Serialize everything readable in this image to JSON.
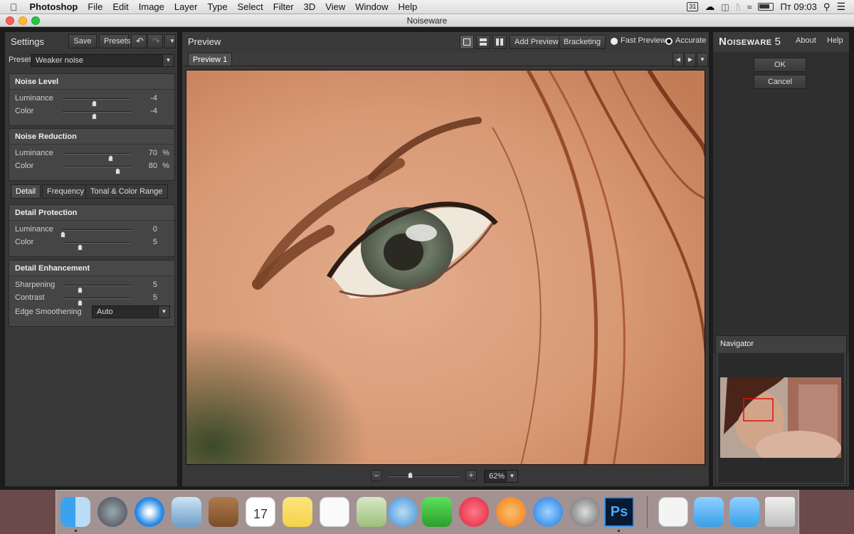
{
  "menubar": {
    "app_name": "Photoshop",
    "items": [
      "File",
      "Edit",
      "Image",
      "Layer",
      "Type",
      "Select",
      "Filter",
      "3D",
      "View",
      "Window",
      "Help"
    ],
    "calendar_tray": "31",
    "clock": "Пт 09:03"
  },
  "window": {
    "title": "Noiseware"
  },
  "settings": {
    "title": "Settings",
    "save_label": "Save",
    "presets_label": "Presets",
    "preset_label": "Preset",
    "preset_value": "Weaker noise",
    "noise_level": {
      "title": "Noise Level",
      "rows": [
        {
          "label": "Luminance",
          "value": "-4",
          "unit": "",
          "pos": 0.46
        },
        {
          "label": "Color",
          "value": "-4",
          "unit": "",
          "pos": 0.46
        }
      ]
    },
    "noise_reduction": {
      "title": "Noise Reduction",
      "rows": [
        {
          "label": "Luminance",
          "value": "70",
          "unit": "%",
          "pos": 0.7
        },
        {
          "label": "Color",
          "value": "80",
          "unit": "%",
          "pos": 0.8
        }
      ]
    },
    "tabs": [
      "Detail",
      "Frequency",
      "Tonal & Color Range"
    ],
    "detail_protection": {
      "title": "Detail Protection",
      "rows": [
        {
          "label": "Luminance",
          "value": "0",
          "unit": "",
          "pos": 0.0
        },
        {
          "label": "Color",
          "value": "5",
          "unit": "",
          "pos": 0.25
        }
      ]
    },
    "detail_enhancement": {
      "title": "Detail Enhancement",
      "rows": [
        {
          "label": "Sharpening",
          "value": "5",
          "unit": "",
          "pos": 0.25
        },
        {
          "label": "Contrast",
          "value": "5",
          "unit": "",
          "pos": 0.25
        }
      ],
      "edge_label": "Edge Smoothening",
      "edge_value": "Auto"
    }
  },
  "preview": {
    "title": "Preview",
    "add_preview": "Add Preview",
    "bracketing": "Bracketing",
    "fast_preview": "Fast Preview",
    "accurate": "Accurate",
    "tab": "Preview 1",
    "zoom_minus": "–",
    "zoom_plus": "+",
    "zoom_value": "62%",
    "zoom_level": 0.3
  },
  "right": {
    "brand_main": "Noiseware",
    "brand_ver": "5",
    "about": "About",
    "help": "Help",
    "ok": "OK",
    "cancel": "Cancel",
    "navigator": "Navigator"
  },
  "colors": {
    "accent_red": "#e01010",
    "panel": "#383838"
  }
}
